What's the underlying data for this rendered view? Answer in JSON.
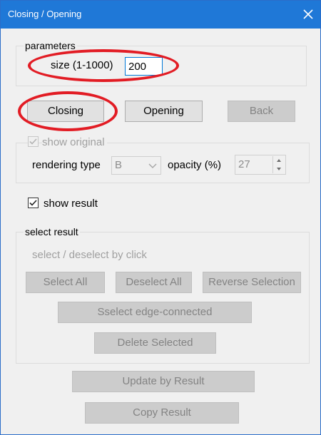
{
  "window": {
    "title": "Closing / Opening"
  },
  "parameters": {
    "legend": "parameters",
    "size_label": "size (1-1000)",
    "size_value": "200"
  },
  "buttons": {
    "closing": "Closing",
    "opening": "Opening",
    "back": "Back"
  },
  "original": {
    "show_original": "show original",
    "rendering_type_label": "rendering type",
    "rendering_type_value": "B",
    "opacity_label": "opacity (%)",
    "opacity_value": "27"
  },
  "result": {
    "show_result": "show result"
  },
  "select_result": {
    "legend": "select result",
    "hint": "select / deselect by click",
    "select_all": "Select All",
    "deselect_all": "Deselect All",
    "reverse_selection": "Reverse Selection",
    "select_edge_connected": "Sselect edge-connected",
    "delete_selected": "Delete Selected"
  },
  "bottom": {
    "update_by_result": "Update by Result",
    "copy_result": "Copy Result"
  },
  "colors": {
    "titlebar": "#1f78d7",
    "annotation": "#e21c24"
  }
}
